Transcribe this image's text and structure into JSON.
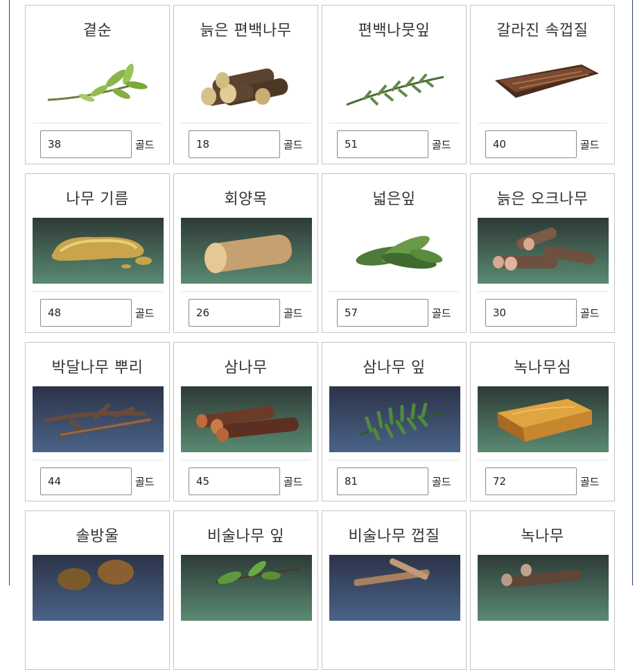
{
  "currency_label": "골드",
  "items": [
    {
      "name": "곁순",
      "price": "38",
      "icon": "sprig-icon",
      "bg": "none"
    },
    {
      "name": "늙은 편백나무",
      "price": "18",
      "icon": "log-pile-icon",
      "bg": "none"
    },
    {
      "name": "편백나뭇잎",
      "price": "51",
      "icon": "cypress-leaf-icon",
      "bg": "none"
    },
    {
      "name": "갈라진 속껍질",
      "price": "40",
      "icon": "bark-icon",
      "bg": "none"
    },
    {
      "name": "나무 기름",
      "price": "48",
      "icon": "oil-puddle-icon",
      "bg": "green"
    },
    {
      "name": "회양목",
      "price": "26",
      "icon": "single-log-icon",
      "bg": "green"
    },
    {
      "name": "넓은잎",
      "price": "57",
      "icon": "broad-leaf-icon",
      "bg": "none"
    },
    {
      "name": "늙은 오크나무",
      "price": "30",
      "icon": "oak-logs-icon",
      "bg": "green"
    },
    {
      "name": "박달나무 뿌리",
      "price": "44",
      "icon": "root-icon",
      "bg": "blue"
    },
    {
      "name": "삼나무",
      "price": "45",
      "icon": "cedar-logs-icon",
      "bg": "green"
    },
    {
      "name": "삼나무 잎",
      "price": "81",
      "icon": "cedar-leaf-icon",
      "bg": "blue"
    },
    {
      "name": "녹나무심",
      "price": "72",
      "icon": "wood-block-icon",
      "bg": "green"
    },
    {
      "name": "솔방울",
      "price": "",
      "icon": "pinecone-icon",
      "bg": "blue"
    },
    {
      "name": "비술나무 잎",
      "price": "",
      "icon": "elm-leaf-icon",
      "bg": "green"
    },
    {
      "name": "비술나무 껍질",
      "price": "",
      "icon": "elm-bark-icon",
      "bg": "blue"
    },
    {
      "name": "녹나무",
      "price": "",
      "icon": "camphor-logs-icon",
      "bg": "green"
    }
  ]
}
